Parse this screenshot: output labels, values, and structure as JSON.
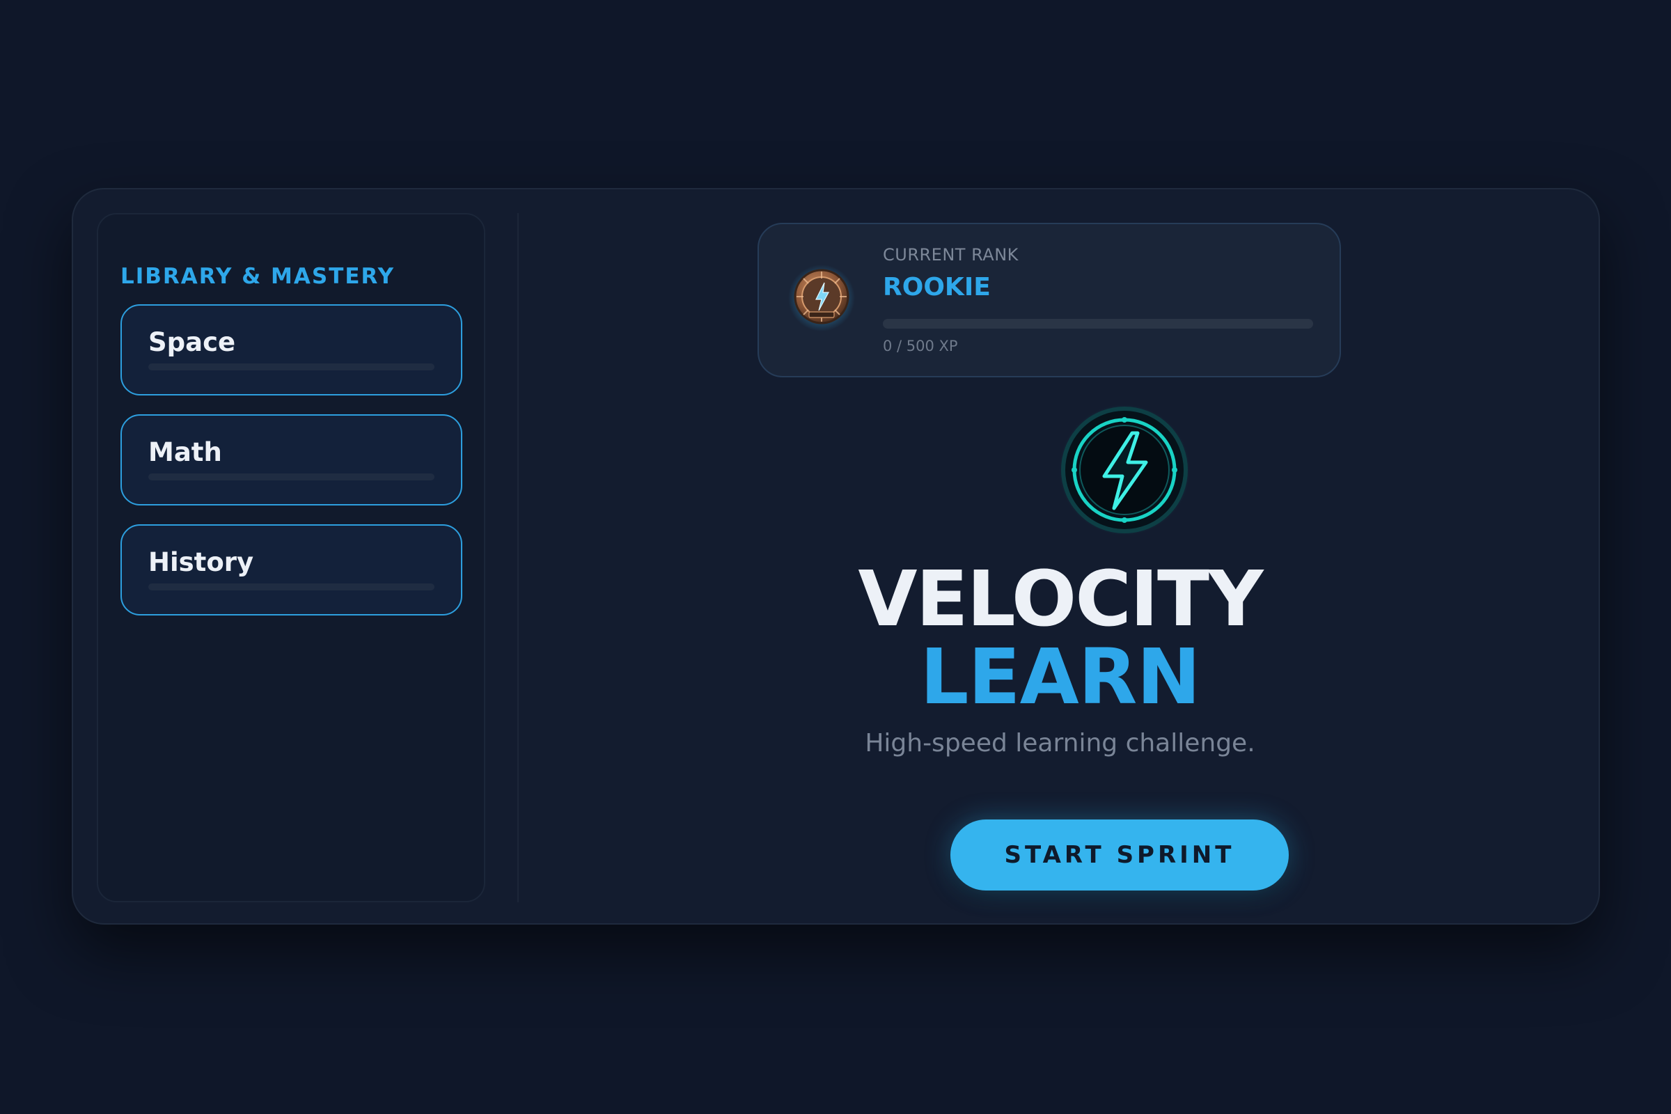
{
  "sidebar": {
    "title": "LIBRARY & MASTERY",
    "items": [
      {
        "label": "Space",
        "progress": 0
      },
      {
        "label": "Math",
        "progress": 0
      },
      {
        "label": "History",
        "progress": 0
      }
    ]
  },
  "rank": {
    "caption": "CURRENT RANK",
    "name": "ROOKIE",
    "xp_current": 0,
    "xp_max": 500,
    "xp_text": "0 / 500 XP",
    "badge_icon": "rookie-badge-icon"
  },
  "hero": {
    "logo_icon": "lightning-bolt-icon",
    "title_line1": "VELOCITY",
    "title_line2": "LEARN",
    "tagline": "High-speed learning challenge.",
    "cta_label": "START SPRINT"
  },
  "colors": {
    "background": "#0f1729",
    "card": "#131c2f",
    "accent": "#35b4ee",
    "accent_text": "#2ea7ea",
    "text": "#edf1f7",
    "muted": "#7a8597"
  }
}
